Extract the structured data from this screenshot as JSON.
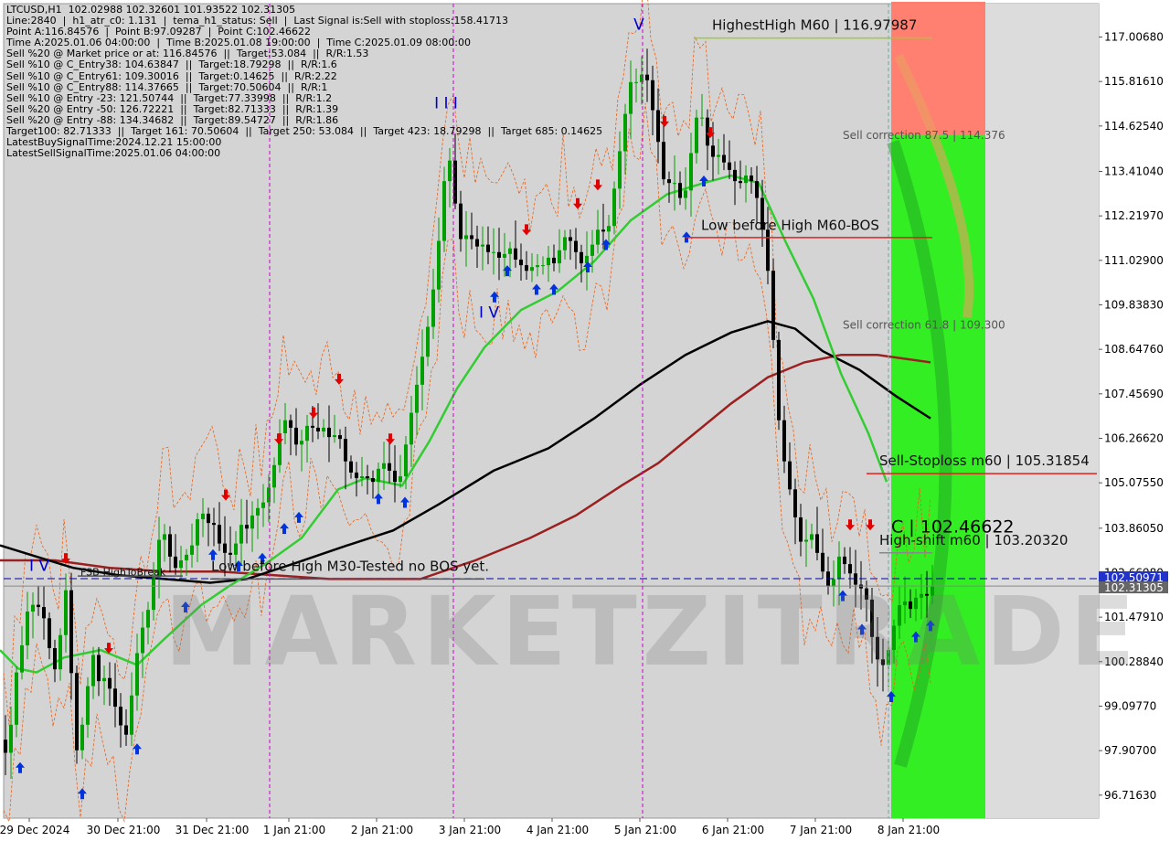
{
  "info_lines": [
    "LTCUSD,H1  102.02988 102.32601 101.93522 102.31305",
    "Line:2840  |  h1_atr_c0: 1.131  |  tema_h1_status: Sell  |  Last Signal is:Sell with stoploss:158.41713",
    "Point A:116.84576  |  Point B:97.09287  |  Point C:102.46622",
    "Time A:2025.01.06 04:00:00  |  Time B:2025.01.08 19:00:00  |  Time C:2025.01.09 08:00:00",
    "Sell %20 @ Market price or at: 116.84576  ||  Target:53.084  ||  R/R:1.53",
    "Sell %10 @ C_Entry38: 104.63847  ||  Target:18.79298  ||  R/R:1.6",
    "Sell %10 @ C_Entry61: 109.30016  ||  Target:0.14625  ||  R/R:2.22",
    "Sell %10 @ C_Entry88: 114.37665  ||  Target:70.50604  ||  R/R:1",
    "Sell %10 @ Entry -23: 121.50744  ||  Target:77.33998  ||  R/R:1.2",
    "Sell %20 @ Entry -50: 126.72221  ||  Target:82.71333  ||  R/R:1.39",
    "Sell %20 @ Entry -88: 134.34682  ||  Target:89.54727  ||  R/R:1.86",
    "Target100: 82.71333  ||  Target 161: 70.50604  ||  Target 250: 53.084  ||  Target 423: 18.79298  ||  Target 685: 0.14625",
    "LatestBuySignalTime:2024.12.21 15:00:00",
    "LatestSellSignalTime:2025.01.06 04:00:00"
  ],
  "watermark": "MARKETZITRADE",
  "colors": {
    "bull": "#00a000",
    "bear": "#000000",
    "fast_ma": "#33cc33",
    "slow_ma": "#000000",
    "long_ma": "#9b2020",
    "band": "#e8621a",
    "buy_arrow": "#0033dd",
    "sell_arrow": "#e00000",
    "red_zone": "#ff8070",
    "green_zone": "#33ee22",
    "pattern": "#0000cc",
    "vline": "#cc00cc"
  },
  "chart_data": {
    "type": "candlestick",
    "symbol": "LTCUSD",
    "timeframe": "H1",
    "ylim": [
      96.1,
      117.9
    ],
    "y_ticks": [
      "117.00680",
      "115.81610",
      "114.62540",
      "113.41040",
      "112.21970",
      "111.02900",
      "109.83830",
      "108.64760",
      "107.45690",
      "106.26620",
      "105.07550",
      "103.86050",
      "102.66980",
      "101.47910",
      "100.28840",
      "99.09770",
      "97.90700",
      "96.71630"
    ],
    "x_ticks": [
      "29 Dec 2024",
      "30 Dec 21:00",
      "31 Dec 21:00",
      "1 Jan 21:00",
      "2 Jan 21:00",
      "3 Jan 21:00",
      "4 Jan 21:00",
      "5 Jan 21:00",
      "6 Jan 21:00",
      "7 Jan 21:00",
      "8 Jan 21:00"
    ],
    "price_labels": [
      "102.50971",
      "102.31305"
    ],
    "close_path": [
      [
        0,
        98.6
      ],
      [
        6,
        98.0
      ],
      [
        10,
        97.4
      ],
      [
        16,
        99.8
      ],
      [
        22,
        100.2
      ],
      [
        30,
        101.6
      ],
      [
        40,
        101.9
      ],
      [
        50,
        101.4
      ],
      [
        56,
        100.5
      ],
      [
        62,
        100.0
      ],
      [
        68,
        101.2
      ],
      [
        74,
        102.4
      ],
      [
        80,
        99.5
      ],
      [
        86,
        97.6
      ],
      [
        92,
        98.8
      ],
      [
        98,
        99.8
      ],
      [
        104,
        100.6
      ],
      [
        110,
        99.6
      ],
      [
        116,
        99.9
      ],
      [
        122,
        99.5
      ],
      [
        128,
        99.0
      ],
      [
        134,
        98.5
      ],
      [
        140,
        98.3
      ],
      [
        146,
        99.6
      ],
      [
        152,
        100.7
      ],
      [
        158,
        101.3
      ],
      [
        166,
        101.9
      ],
      [
        172,
        103.2
      ],
      [
        178,
        103.9
      ],
      [
        184,
        103.5
      ],
      [
        190,
        102.7
      ],
      [
        196,
        102.9
      ],
      [
        202,
        103.1
      ],
      [
        208,
        103.2
      ],
      [
        214,
        103.6
      ],
      [
        220,
        104.6
      ],
      [
        226,
        103.9
      ],
      [
        232,
        104.1
      ],
      [
        238,
        103.8
      ],
      [
        244,
        103.1
      ],
      [
        250,
        103.3
      ],
      [
        256,
        103.0
      ],
      [
        262,
        103.9
      ],
      [
        268,
        104.0
      ],
      [
        274,
        103.7
      ],
      [
        280,
        104.7
      ],
      [
        286,
        104.1
      ],
      [
        292,
        105.0
      ],
      [
        298,
        104.9
      ],
      [
        304,
        106.2
      ],
      [
        310,
        106.6
      ],
      [
        316,
        106.9
      ],
      [
        322,
        106.2
      ],
      [
        328,
        106.0
      ],
      [
        334,
        106.4
      ],
      [
        340,
        106.8
      ],
      [
        346,
        106.3
      ],
      [
        352,
        106.6
      ],
      [
        358,
        106.5
      ],
      [
        364,
        106.1
      ],
      [
        370,
        106.6
      ],
      [
        376,
        105.9
      ],
      [
        382,
        105.4
      ],
      [
        388,
        105.3
      ],
      [
        394,
        105.1
      ],
      [
        400,
        105.4
      ],
      [
        406,
        105.0
      ],
      [
        412,
        105.2
      ],
      [
        418,
        105.7
      ],
      [
        424,
        105.5
      ],
      [
        430,
        105.3
      ],
      [
        436,
        104.9
      ],
      [
        442,
        105.6
      ],
      [
        448,
        106.6
      ],
      [
        454,
        107.3
      ],
      [
        460,
        108.1
      ],
      [
        466,
        108.8
      ],
      [
        472,
        109.7
      ],
      [
        478,
        110.8
      ],
      [
        484,
        112.3
      ],
      [
        490,
        114.0
      ],
      [
        496,
        113.4
      ],
      [
        502,
        111.7
      ],
      [
        508,
        111.5
      ],
      [
        514,
        111.9
      ],
      [
        520,
        111.3
      ],
      [
        526,
        111.5
      ],
      [
        532,
        111.4
      ],
      [
        538,
        111.1
      ],
      [
        544,
        111.4
      ],
      [
        550,
        110.8
      ],
      [
        556,
        111.6
      ],
      [
        562,
        111.1
      ],
      [
        568,
        111.0
      ],
      [
        574,
        110.8
      ],
      [
        580,
        110.7
      ],
      [
        586,
        111.0
      ],
      [
        592,
        110.8
      ],
      [
        598,
        111.0
      ],
      [
        604,
        111.2
      ],
      [
        610,
        110.7
      ],
      [
        616,
        111.9
      ],
      [
        622,
        111.4
      ],
      [
        628,
        111.7
      ],
      [
        634,
        110.8
      ],
      [
        640,
        111.1
      ],
      [
        646,
        111.2
      ],
      [
        652,
        111.7
      ],
      [
        658,
        112.0
      ],
      [
        664,
        111.6
      ],
      [
        670,
        112.3
      ],
      [
        676,
        113.6
      ],
      [
        682,
        114.3
      ],
      [
        688,
        115.6
      ],
      [
        694,
        116.0
      ],
      [
        700,
        115.6
      ],
      [
        706,
        116.4
      ],
      [
        712,
        115.3
      ],
      [
        718,
        114.8
      ],
      [
        724,
        113.6
      ],
      [
        730,
        112.8
      ],
      [
        736,
        113.4
      ],
      [
        742,
        112.8
      ],
      [
        748,
        112.6
      ],
      [
        754,
        113.2
      ],
      [
        760,
        114.6
      ],
      [
        766,
        115.1
      ],
      [
        772,
        114.6
      ],
      [
        778,
        113.6
      ],
      [
        784,
        114.0
      ],
      [
        790,
        113.7
      ],
      [
        796,
        113.6
      ],
      [
        802,
        113.3
      ],
      [
        808,
        113.0
      ],
      [
        814,
        113.2
      ],
      [
        820,
        113.4
      ],
      [
        826,
        112.9
      ],
      [
        832,
        112.5
      ],
      [
        838,
        111.2
      ],
      [
        844,
        110.3
      ],
      [
        850,
        107.5
      ],
      [
        856,
        106.0
      ],
      [
        862,
        105.3
      ],
      [
        868,
        104.5
      ],
      [
        874,
        103.8
      ],
      [
        880,
        103.2
      ],
      [
        886,
        103.9
      ],
      [
        892,
        103.5
      ],
      [
        898,
        102.9
      ],
      [
        904,
        102.5
      ],
      [
        910,
        102.1
      ],
      [
        916,
        102.9
      ],
      [
        922,
        103.3
      ],
      [
        928,
        102.5
      ],
      [
        934,
        102.8
      ],
      [
        940,
        101.9
      ],
      [
        946,
        102.6
      ],
      [
        952,
        101.3
      ],
      [
        958,
        100.6
      ],
      [
        964,
        100.1
      ],
      [
        970,
        100.3
      ],
      [
        976,
        100.9
      ],
      [
        982,
        101.6
      ],
      [
        988,
        102.0
      ],
      [
        994,
        101.8
      ],
      [
        1000,
        101.6
      ],
      [
        1006,
        102.4
      ],
      [
        1012,
        101.8
      ],
      [
        1018,
        102.31
      ]
    ],
    "fast_ma": [
      [
        0,
        100.6
      ],
      [
        20,
        100.1
      ],
      [
        40,
        100.0
      ],
      [
        70,
        100.4
      ],
      [
        110,
        100.6
      ],
      [
        150,
        100.2
      ],
      [
        180,
        100.9
      ],
      [
        220,
        101.8
      ],
      [
        250,
        102.3
      ],
      [
        290,
        102.9
      ],
      [
        330,
        103.6
      ],
      [
        370,
        104.9
      ],
      [
        400,
        105.2
      ],
      [
        440,
        105.0
      ],
      [
        470,
        106.2
      ],
      [
        500,
        107.6
      ],
      [
        530,
        108.7
      ],
      [
        570,
        109.7
      ],
      [
        610,
        110.2
      ],
      [
        650,
        111.0
      ],
      [
        690,
        112.1
      ],
      [
        730,
        112.8
      ],
      [
        770,
        113.1
      ],
      [
        800,
        113.3
      ],
      [
        830,
        113.1
      ],
      [
        860,
        111.5
      ],
      [
        890,
        110.0
      ],
      [
        920,
        108.0
      ],
      [
        950,
        106.4
      ],
      [
        970,
        105.1
      ]
    ],
    "slow_ma": [
      [
        0,
        103.4
      ],
      [
        40,
        103.1
      ],
      [
        80,
        102.8
      ],
      [
        130,
        102.6
      ],
      [
        180,
        102.5
      ],
      [
        230,
        102.4
      ],
      [
        270,
        102.5
      ],
      [
        320,
        102.9
      ],
      [
        380,
        103.4
      ],
      [
        430,
        103.8
      ],
      [
        480,
        104.5
      ],
      [
        540,
        105.4
      ],
      [
        600,
        106.0
      ],
      [
        650,
        106.8
      ],
      [
        700,
        107.7
      ],
      [
        750,
        108.5
      ],
      [
        800,
        109.1
      ],
      [
        840,
        109.4
      ],
      [
        870,
        109.2
      ],
      [
        900,
        108.6
      ],
      [
        940,
        108.1
      ],
      [
        980,
        107.4
      ],
      [
        1018,
        106.8
      ]
    ],
    "long_ma": [
      [
        0,
        103.0
      ],
      [
        60,
        103.0
      ],
      [
        120,
        102.8
      ],
      [
        180,
        102.7
      ],
      [
        240,
        102.7
      ],
      [
        300,
        102.6
      ],
      [
        360,
        102.5
      ],
      [
        420,
        102.5
      ],
      [
        460,
        102.5
      ],
      [
        520,
        103.0
      ],
      [
        580,
        103.6
      ],
      [
        630,
        104.2
      ],
      [
        680,
        105.0
      ],
      [
        720,
        105.6
      ],
      [
        760,
        106.4
      ],
      [
        800,
        107.2
      ],
      [
        840,
        107.9
      ],
      [
        880,
        108.3
      ],
      [
        920,
        108.5
      ],
      [
        960,
        108.5
      ],
      [
        1018,
        108.3
      ]
    ],
    "wave_labels": [
      {
        "label": "I V",
        "x": 43,
        "y": 102.72
      },
      {
        "label": "I I I",
        "x": 488,
        "y": 115.1
      },
      {
        "label": "I V",
        "x": 535,
        "y": 109.5
      },
      {
        "label": "V",
        "x": 699,
        "y": 117.2
      }
    ],
    "vertical_lines": [
      295,
      496,
      703,
      972
    ],
    "levels": [
      {
        "label": "HighestHigh    M60 | 116.97987",
        "x0": 760,
        "x1": 1020,
        "y": 116.98,
        "color": "#9acd32",
        "tx": 779,
        "ty": 117.2
      },
      {
        "label": "Low before High    M60-BOS",
        "x0": 750,
        "x1": 1020,
        "y": 111.64,
        "color": "#dd2222",
        "tx": 767,
        "ty": 111.85
      },
      {
        "label": "Sell-Stoploss m60 | 105.31854",
        "x0": 948,
        "x1": 1200,
        "y": 105.32,
        "color": "#dd2222",
        "tx": 962,
        "ty": 105.55
      },
      {
        "label": "High-shift m60 | 103.20320",
        "x0": 962,
        "x1": 1020,
        "y": 103.2,
        "color": "#888888",
        "tx": 962,
        "ty": 103.42
      },
      {
        "label": "Low before High  M30-Tested no BOS yet.",
        "x0": 230,
        "x1": 530,
        "y": 102.5,
        "color": "#555555",
        "tx": 231,
        "ty": 102.72
      },
      {
        "label": "FSB-HighToBreak",
        "x0": 85,
        "x1": 200,
        "y": 102.58,
        "color": "#555555",
        "tx": 88,
        "ty": 102.6
      }
    ],
    "corrections": [
      {
        "label": "Sell correction 87.5 | 114.376",
        "y": 114.376
      },
      {
        "label": "Sell correction 61.8 | 109.300",
        "y": 109.3
      }
    ],
    "point_c_label": "C | 102.46622",
    "buy_arrows": [
      [
        22,
        97.6
      ],
      [
        90,
        96.9
      ],
      [
        150,
        98.1
      ],
      [
        203,
        101.9
      ],
      [
        233,
        103.3
      ],
      [
        261,
        103.0
      ],
      [
        287,
        103.2
      ],
      [
        311,
        104.0
      ],
      [
        327,
        104.3
      ],
      [
        414,
        104.8
      ],
      [
        443,
        104.7
      ],
      [
        541,
        110.2
      ],
      [
        555,
        110.9
      ],
      [
        587,
        110.4
      ],
      [
        606,
        110.4
      ],
      [
        643,
        111.0
      ],
      [
        663,
        111.6
      ],
      [
        751,
        111.8
      ],
      [
        770,
        113.3
      ],
      [
        922,
        102.2
      ],
      [
        943,
        101.3
      ],
      [
        975,
        99.5
      ],
      [
        1002,
        101.1
      ],
      [
        1018,
        101.4
      ]
    ],
    "sell_arrows": [
      [
        72,
        102.9
      ],
      [
        119,
        100.5
      ],
      [
        247,
        104.6
      ],
      [
        305,
        106.1
      ],
      [
        343,
        106.8
      ],
      [
        371,
        107.7
      ],
      [
        427,
        106.1
      ],
      [
        576,
        111.7
      ],
      [
        632,
        112.4
      ],
      [
        654,
        112.9
      ],
      [
        727,
        114.6
      ],
      [
        777,
        114.3
      ],
      [
        930,
        103.8
      ],
      [
        952,
        103.8
      ]
    ],
    "zones": {
      "x0": 975,
      "x1": 1078,
      "red_top": 117.95,
      "red_bottom": 114.376,
      "green_top": 114.376,
      "green_bottom": 96.1
    },
    "current_price": 102.50971,
    "bid_price": 102.31305
  }
}
